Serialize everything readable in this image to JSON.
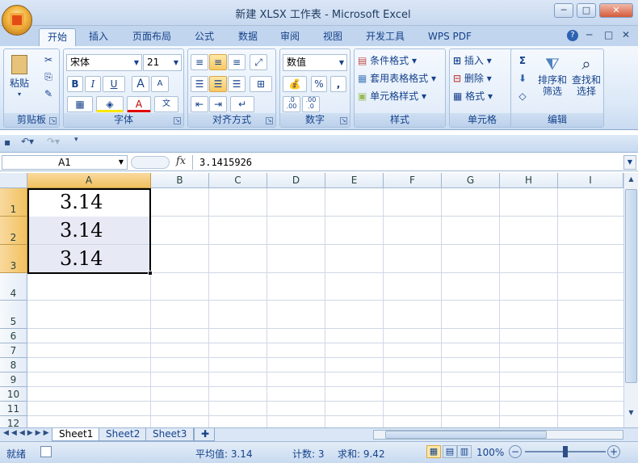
{
  "window": {
    "title": "新建 XLSX 工作表 - Microsoft Excel",
    "controls": [
      "─",
      "□",
      "✕"
    ]
  },
  "tabs": [
    "开始",
    "插入",
    "页面布局",
    "公式",
    "数据",
    "审阅",
    "视图",
    "开发工具",
    "WPS PDF"
  ],
  "ribbon": {
    "clipboard": {
      "paste": "粘贴",
      "label": "剪贴板"
    },
    "font": {
      "name": "宋体",
      "size": "21",
      "bold": "B",
      "italic": "I",
      "underline": "U",
      "grow": "A",
      "shrink": "A",
      "label": "字体"
    },
    "alignment": {
      "label": "对齐方式"
    },
    "number": {
      "format": "数值",
      "percent": "%",
      "comma": ",",
      "inc": ".0\n.00",
      "dec": ".00\n.0",
      "label": "数字"
    },
    "styles": {
      "conditional": "条件格式",
      "table": "套用表格格式",
      "cell": "单元格样式",
      "label": "样式"
    },
    "cells": {
      "insert": "插入",
      "delete": "删除",
      "format": "格式",
      "label": "单元格"
    },
    "editing": {
      "sigma": "Σ",
      "sort": "排序和",
      "sort2": "筛选",
      "find": "查找和",
      "find2": "选择",
      "label": "编辑"
    }
  },
  "formula_bar": {
    "name_box": "A1",
    "fx": "fx",
    "formula": "3.1415926"
  },
  "columns": [
    "A",
    "B",
    "C",
    "D",
    "E",
    "F",
    "G",
    "H",
    "I"
  ],
  "rows": [
    "1",
    "2",
    "3",
    "4",
    "5",
    "6",
    "7",
    "8",
    "9",
    "10",
    "11",
    "12"
  ],
  "cells": {
    "A1": "3.14",
    "A2": "3.14",
    "A3": "3.14"
  },
  "sheets": [
    "Sheet1",
    "Sheet2",
    "Sheet3"
  ],
  "status": {
    "ready": "就绪",
    "average": "平均值: 3.14",
    "count": "计数: 3",
    "sum": "求和: 9.42",
    "zoom": "100%"
  }
}
